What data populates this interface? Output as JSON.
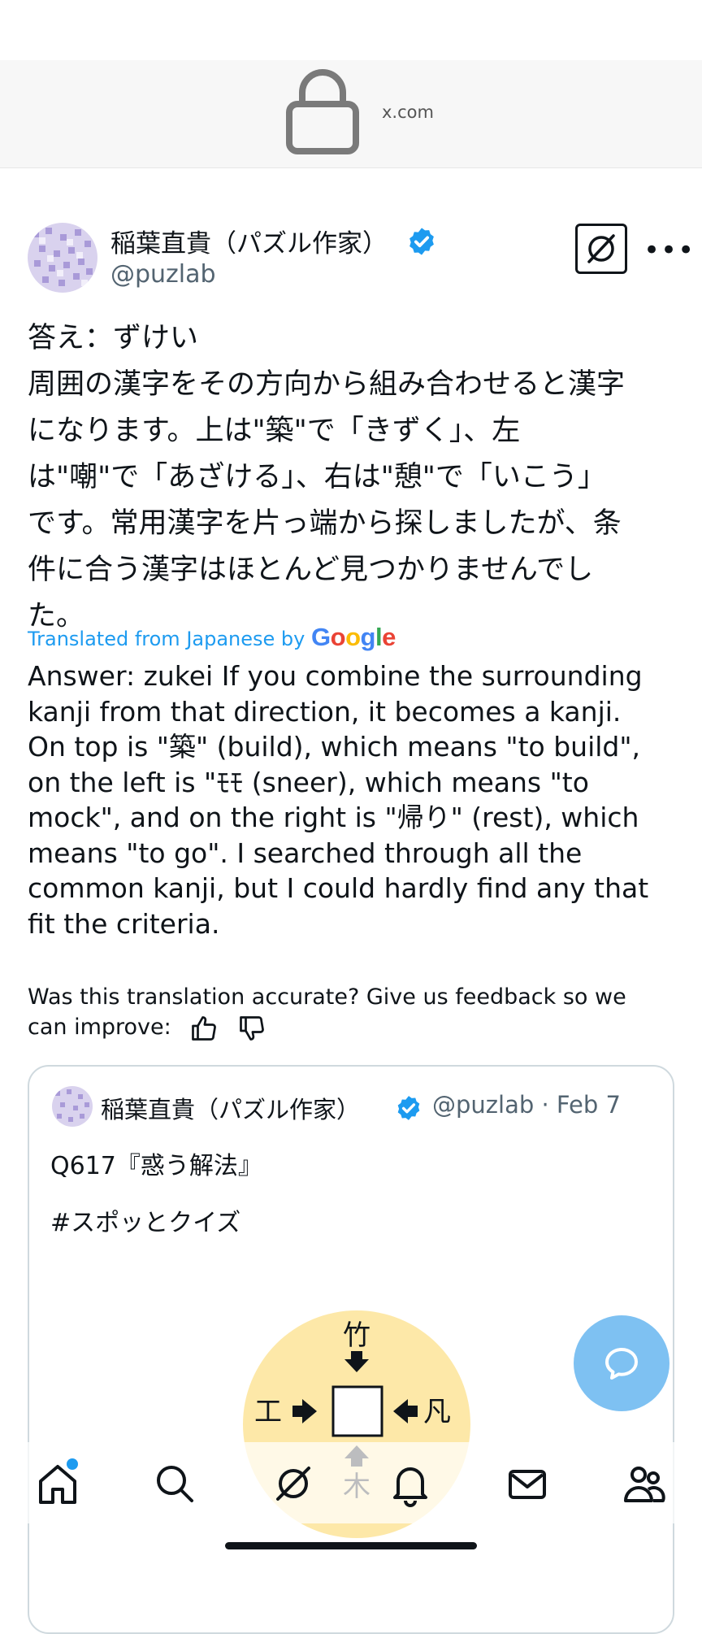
{
  "browser": {
    "domain": "x.com"
  },
  "tweet": {
    "author_name": "稲葉直貴（パズル作家）",
    "author_handle": "@puzlab",
    "original_lines": [
      "答え：ずけい",
      "周囲の漢字をその方向から組み合わせると漢字",
      "になります。上は\"築\"で「きずく」、左",
      "は\"嘲\"で「あざける」、右は\"憩\"で「いこう」",
      "です。常用漢字を片っ端から探しましたが、条",
      "件に合う漢字はほとんど見つかりませんでし",
      "た。"
    ],
    "translated_label": "Translated from Japanese by",
    "translator_logo": "Google",
    "translation_lines": [
      "Answer: zukei If you combine the surrounding",
      "kanji from that direction, it becomes a kanji.",
      "On top is \"築\" (build), which means \"to build\",",
      "on the left is \"ﾓﾓ (sneer), which means \"to",
      "mock\", and on the right is \"帰り\" (rest), which",
      "means \"to go\". I searched through all the",
      "common kanji, but I could hardly find any that",
      "fit the criteria."
    ],
    "feedback_text_line1": "Was this translation accurate? Give us feedback so we",
    "feedback_text_line2": "can improve:"
  },
  "quoted_tweet": {
    "author_name": "稲葉直貴（パズル作家）",
    "meta": "@puzlab · Feb 7",
    "line1": "Q617『惑う解法』",
    "line2": "#スポッとクイズ",
    "puzzle": {
      "top": "竹",
      "left": "工",
      "right": "凡",
      "bottom": "木"
    }
  },
  "icons": {
    "lock": "lock-icon",
    "verified": "verified-badge-icon",
    "grok": "grok-icon",
    "more": "more-icon",
    "thumbs_up": "thumbs-up-icon",
    "thumbs_down": "thumbs-down-icon",
    "compose": "compose-icon",
    "nav": [
      "home-icon",
      "search-icon",
      "grok-icon",
      "notifications-icon",
      "messages-icon",
      "communities-icon"
    ]
  },
  "colors": {
    "accent": "#1d9bf0",
    "fab": "#7ec1f2",
    "puzzle_circle": "#fde8a8"
  }
}
